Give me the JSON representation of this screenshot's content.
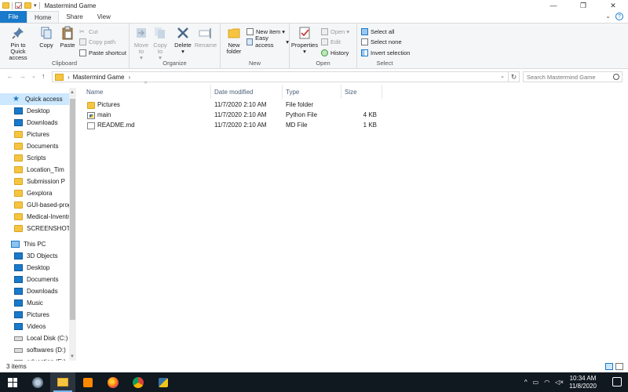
{
  "window": {
    "title": "Mastermind Game",
    "minimize_glyph": "—",
    "maximize_glyph": "❐",
    "close_glyph": "✕"
  },
  "tabs": [
    {
      "label": "File"
    },
    {
      "label": "Home"
    },
    {
      "label": "Share"
    },
    {
      "label": "View"
    }
  ],
  "ribbon": {
    "clipboard": {
      "label": "Clipboard",
      "pin": "Pin to Quick access",
      "copy": "Copy",
      "paste": "Paste",
      "cut": "Cut",
      "copy_path": "Copy path",
      "paste_shortcut": "Paste shortcut"
    },
    "organize": {
      "label": "Organize",
      "move_to": "Move to",
      "copy_to": "Copy to",
      "delete": "Delete",
      "rename": "Rename"
    },
    "new": {
      "label": "New",
      "new_folder": "New folder",
      "new_item": "New item",
      "easy_access": "Easy access"
    },
    "open": {
      "label": "Open",
      "properties": "Properties",
      "open": "Open",
      "edit": "Edit",
      "history": "History"
    },
    "select": {
      "label": "Select",
      "select_all": "Select all",
      "select_none": "Select none",
      "invert": "Invert selection"
    }
  },
  "address": {
    "path": "Mastermind Game",
    "search_placeholder": "Search Mastermind Game"
  },
  "nav": {
    "quick_access": "Quick access",
    "quick_items": [
      "Desktop",
      "Downloads",
      "Pictures",
      "Documents",
      "Scripts",
      "Location_Tim",
      "Submission P",
      "Gexplora",
      "GUI-based-prog",
      "Medical-Inventry",
      "SCREENSHOTS"
    ],
    "this_pc": "This PC",
    "pc_items": [
      "3D Objects",
      "Desktop",
      "Documents",
      "Downloads",
      "Music",
      "Pictures",
      "Videos",
      "Local Disk (C:)",
      "softwares (D:)",
      "education (E:)"
    ]
  },
  "columns": {
    "name": "Name",
    "date": "Date modified",
    "type": "Type",
    "size": "Size"
  },
  "files": [
    {
      "name": "Pictures",
      "date": "11/7/2020 2:10 AM",
      "type": "File folder",
      "size": "",
      "icon": "folder-icon"
    },
    {
      "name": "main",
      "date": "11/7/2020 2:10 AM",
      "type": "Python File",
      "size": "4 KB",
      "icon": "python-file-icon"
    },
    {
      "name": "README.md",
      "date": "11/7/2020 2:10 AM",
      "type": "MD File",
      "size": "1 KB",
      "icon": "document-icon"
    }
  ],
  "status": {
    "items_count": "3 items"
  },
  "taskbar": {
    "time": "10:34 AM",
    "date": "11/8/2020"
  },
  "colors": {
    "accent": "#1979ca",
    "selection": "#cce8ff",
    "taskbar": "#101820"
  }
}
